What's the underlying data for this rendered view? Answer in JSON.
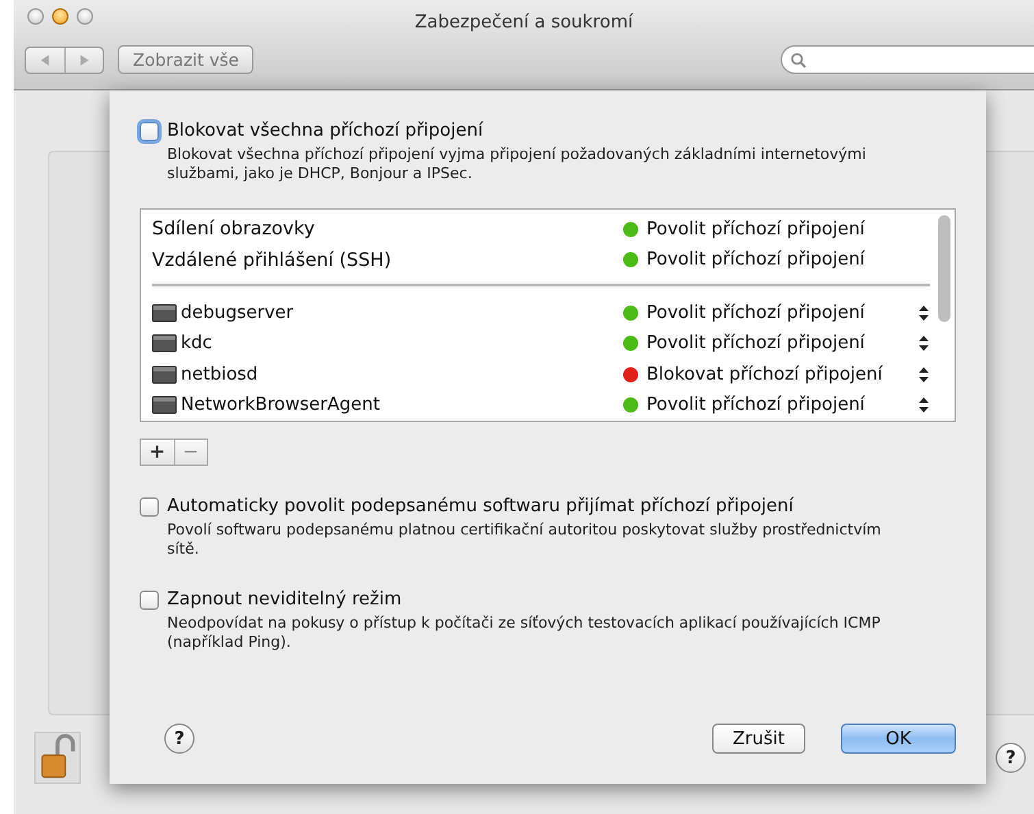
{
  "window": {
    "title": "Zabezpečení a soukromí",
    "show_all_button": "Zobrazit vše"
  },
  "sheet": {
    "block_all": {
      "label": "Blokovat všechna příchozí připojení",
      "checked": false,
      "description": "Blokovat všechna příchozí připojení vyjma připojení požadovaných základními internetovými službami, jako je DHCP, Bonjour a IPSec."
    },
    "services": [
      {
        "name": "Sdílení obrazovky",
        "status": "Povolit příchozí připojení",
        "color": "#4cbb17"
      },
      {
        "name": "Vzdálené přihlášení (SSH)",
        "status": "Povolit příchozí připojení",
        "color": "#4cbb17"
      }
    ],
    "apps": [
      {
        "name": "debugserver",
        "status": "Povolit příchozí připojení",
        "color": "#4cbb17"
      },
      {
        "name": "kdc",
        "status": "Povolit příchozí připojení",
        "color": "#4cbb17"
      },
      {
        "name": "netbiosd",
        "status": "Blokovat příchozí připojení",
        "color": "#e0201b"
      },
      {
        "name": "NetworkBrowserAgent",
        "status": "Povolit příchozí připojení",
        "color": "#4cbb17"
      }
    ],
    "add_button": "+",
    "remove_button": "−",
    "options": [
      {
        "label": "Automaticky povolit podepsanému softwaru přijímat příchozí připojení",
        "checked": false,
        "description": "Povolí softwaru podepsanému platnou certifikační autoritou poskytovat služby prostřednictvím sítě."
      },
      {
        "label": "Zapnout neviditelný režim",
        "checked": false,
        "description": "Neodpovídat na pokusy o přístup k počítači ze síťových testovacích aplikací používajících ICMP (například Ping)."
      }
    ],
    "help_button": "?",
    "cancel_button": "Zrušit",
    "ok_button": "OK"
  },
  "footer": {
    "help_button": "?"
  }
}
